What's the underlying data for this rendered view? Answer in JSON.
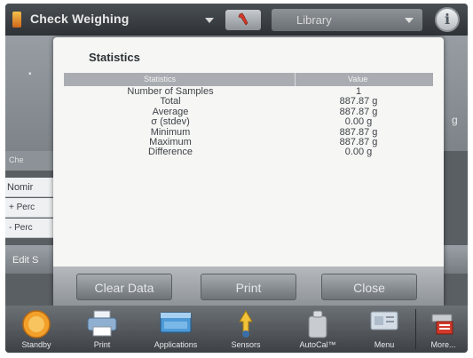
{
  "header": {
    "app_title": "Check Weighing",
    "library_label": "Library",
    "info_label": "i"
  },
  "background": {
    "unit": "g",
    "left_labels": [
      "Che",
      "Nomir",
      "+ Perc",
      "- Perc"
    ],
    "edit_label": "Edit S"
  },
  "dialog": {
    "title": "Statistics",
    "columns": {
      "statistics": "Statistics",
      "value": "Value"
    },
    "rows": [
      {
        "label": "Number of Samples",
        "value": "1"
      },
      {
        "label": "Total",
        "value": "887.87 g"
      },
      {
        "label": "Average",
        "value": "887.87 g"
      },
      {
        "label": "σ (stdev)",
        "value": "0.00 g"
      },
      {
        "label": "Minimum",
        "value": "887.87 g"
      },
      {
        "label": "Maximum",
        "value": "887.87 g"
      },
      {
        "label": "Difference",
        "value": "0.00 g"
      }
    ],
    "buttons": {
      "clear": "Clear Data",
      "print": "Print",
      "close": "Close"
    }
  },
  "dock": {
    "items": [
      {
        "label": "Standby",
        "icon": "standby-icon"
      },
      {
        "label": "Print",
        "icon": "printer-icon"
      },
      {
        "label": "Applications",
        "icon": "applications-icon"
      },
      {
        "label": "Sensors",
        "icon": "sensors-icon"
      },
      {
        "label": "AutoCal™",
        "icon": "autocal-icon"
      },
      {
        "label": "Menu",
        "icon": "menu-icon"
      },
      {
        "label": "More...",
        "icon": "more-icon"
      }
    ]
  },
  "colors": {
    "accent_orange": "#f2a02a",
    "dialog_bg": "#f6f6f5",
    "header_bar": "#a9adb1"
  }
}
